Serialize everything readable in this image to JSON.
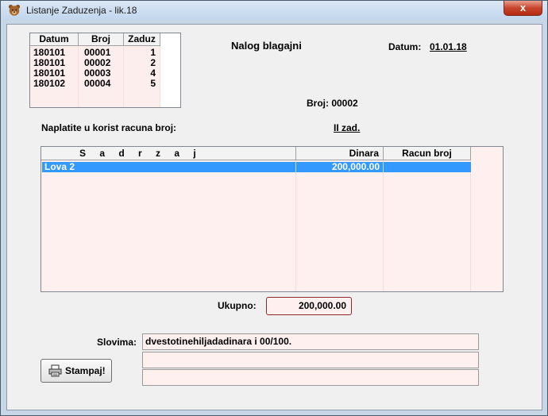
{
  "window": {
    "title": "Listanje Zaduzenja - lik.18",
    "close_glyph": "x",
    "icon": "teddy-bear-icon"
  },
  "header": {
    "nalog_title": "Nalog blagajni",
    "datum_label": "Datum:",
    "datum_value": "01.01.18",
    "broj_label": "Broj: 00002",
    "naplatite_label": "Naplatite u korist racuna broj:",
    "account_value": "II zad."
  },
  "small_list": {
    "columns": [
      "Datum",
      "Broj",
      "Zaduz"
    ],
    "rows": [
      [
        "180101",
        "00001",
        "1"
      ],
      [
        "180101",
        "00002",
        "2"
      ],
      [
        "180101",
        "00003",
        "4"
      ],
      [
        "180102",
        "00004",
        "5"
      ]
    ]
  },
  "main_list": {
    "columns": [
      "S a d r z a j",
      "Dinara",
      "Racun broj"
    ],
    "rows": [
      [
        "Lova 2",
        "200,000.00",
        ""
      ]
    ]
  },
  "totals": {
    "label": "Ukupno:",
    "value": "200,000.00"
  },
  "slovima": {
    "label": "Slovima:",
    "lines": [
      "dvestotinehiljadadinara i 00/100.",
      "",
      ""
    ]
  },
  "buttons": {
    "print_label": "Stampaj!"
  },
  "colors": {
    "selection": "#3399ff",
    "list_background": "#fff0f0",
    "total_border": "#8a2b2b"
  }
}
